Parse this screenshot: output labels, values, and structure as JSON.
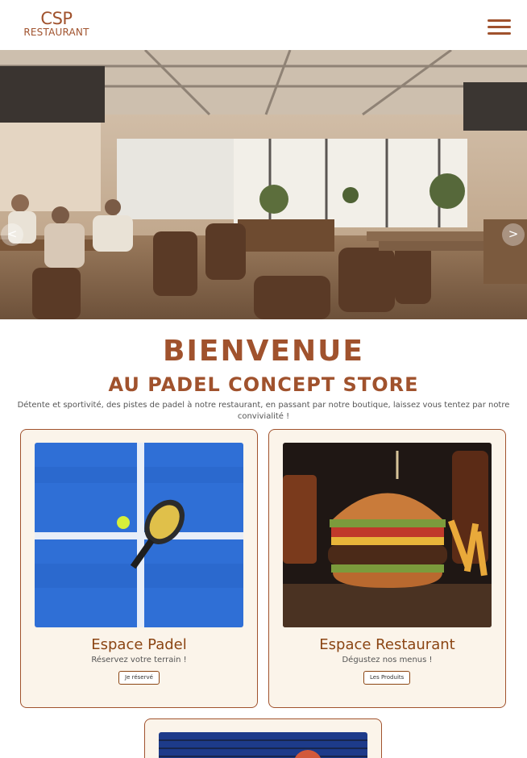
{
  "header": {
    "logo_main": "CSP",
    "logo_sub": "RESTAURANT"
  },
  "hero": {
    "prev": "<",
    "next": ">"
  },
  "welcome": {
    "title": "BIENVENUE",
    "subtitle": "AU PADEL CONCEPT STORE",
    "text": "Détente et sportivité, des pistes de padel à notre restaurant, en passant par notre boutique, laissez vous tentez par notre convivialité !"
  },
  "cards": [
    {
      "title": "Espace Padel",
      "subtitle": "Réservez votre terrain !",
      "button": "Je réservé"
    },
    {
      "title": "Espace Restaurant",
      "subtitle": "Dégustez nos menus !",
      "button": "Les Produits"
    }
  ],
  "colors": {
    "brand": "#a0522d",
    "card_bg": "#fbf4ea",
    "padel_blue": "#2f6fd6"
  },
  "icons": [
    "menu-icon",
    "chevron-left-icon",
    "chevron-right-icon"
  ]
}
